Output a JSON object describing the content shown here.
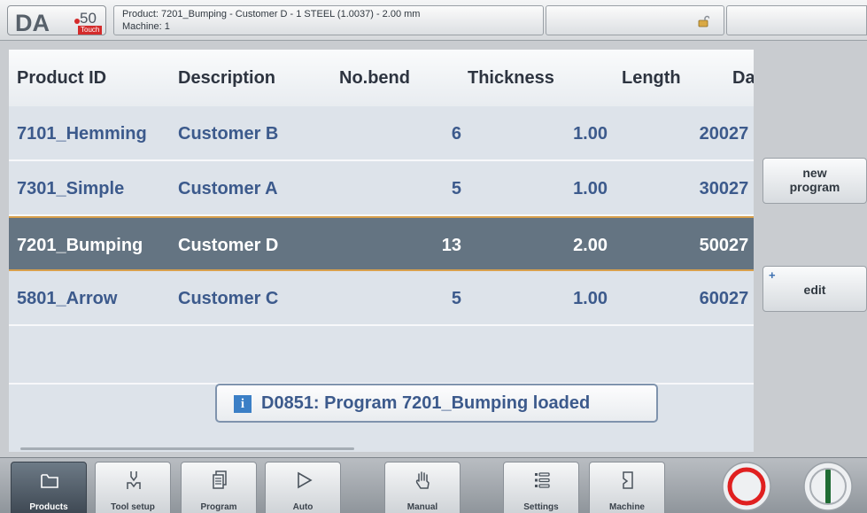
{
  "header": {
    "logo": {
      "brand": "DA",
      "model": "50",
      "edition": "Touch"
    },
    "product_line": "Product: 7201_Bumping - Customer D - 1 STEEL (1.0037) - 2.00 mm",
    "machine_line": "Machine: 1",
    "lock_icon": "unlocked-padlock-icon"
  },
  "table": {
    "columns": [
      "Product ID",
      "Description",
      "No.bend",
      "Thickness",
      "Length",
      "Da"
    ],
    "rows": [
      {
        "id": "7101_Hemming",
        "description": "Customer B",
        "no_bend": "6",
        "thickness": "1.00",
        "length": "200",
        "da": "27"
      },
      {
        "id": "7301_Simple",
        "description": "Customer A",
        "no_bend": "5",
        "thickness": "1.00",
        "length": "300",
        "da": "27"
      },
      {
        "id": "7201_Bumping",
        "description": "Customer D",
        "no_bend": "13",
        "thickness": "2.00",
        "length": "500",
        "da": "27"
      },
      {
        "id": "5801_Arrow",
        "description": "Customer C",
        "no_bend": "5",
        "thickness": "1.00",
        "length": "600",
        "da": "27"
      }
    ],
    "selected_index": 2
  },
  "message": {
    "icon": "info-icon",
    "text": "D0851: Program 7201_Bumping loaded"
  },
  "side": {
    "new_program_line1": "new",
    "new_program_line2": "program",
    "edit_label": "edit",
    "edit_marker": "+"
  },
  "tabs": [
    {
      "label": "Products",
      "icon": "folder-icon",
      "active": true
    },
    {
      "label": "Tool setup",
      "icon": "punch-die-icon",
      "active": false
    },
    {
      "label": "Program",
      "icon": "pages-icon",
      "active": false
    },
    {
      "label": "Auto",
      "icon": "play-icon",
      "active": false
    },
    {
      "label": "Manual",
      "icon": "hand-icon",
      "active": false
    },
    {
      "label": "Settings",
      "icon": "list-icon",
      "active": false
    },
    {
      "label": "Machine",
      "icon": "machine-icon",
      "active": false
    }
  ],
  "controls": {
    "stop_icon": "stop-circle-icon",
    "start_icon": "start-circle-icon",
    "stop_color": "#e02020",
    "start_color": "#1f6b33"
  }
}
